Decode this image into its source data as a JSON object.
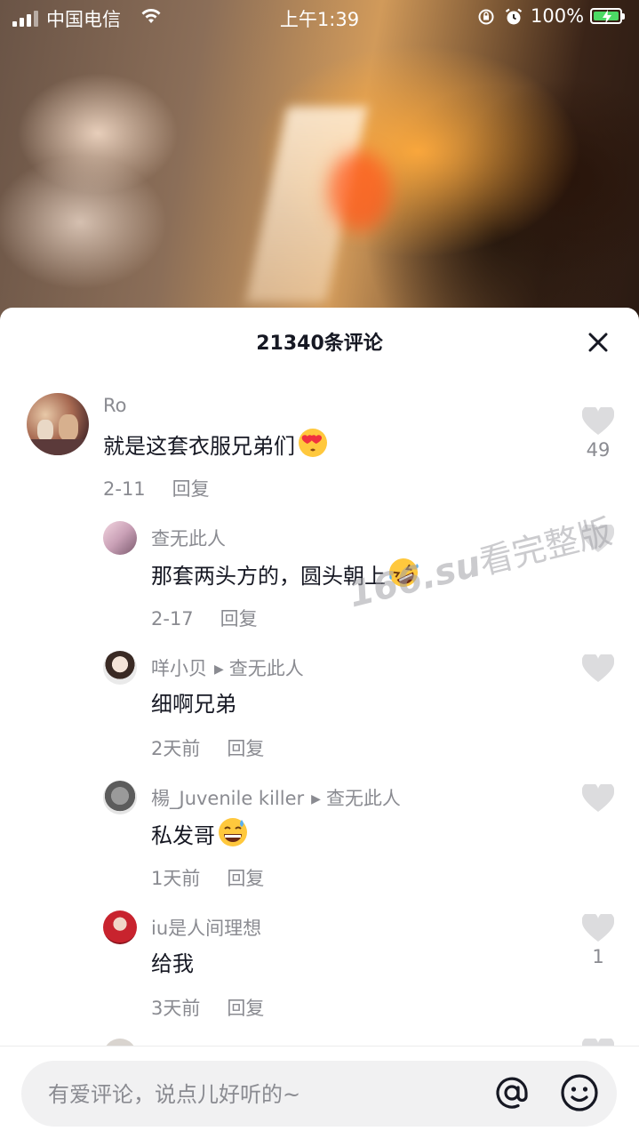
{
  "status_bar": {
    "carrier": "中国电信",
    "time": "上午1:39",
    "battery": "100%"
  },
  "comments_sheet": {
    "title": "21340条评论",
    "comments": [
      {
        "user": "Ro",
        "text": "就是这套衣服兄弟们",
        "emoji": "heart-eyes-emoji",
        "date": "2-11",
        "reply_label": "回复",
        "likes": "49"
      },
      {
        "user": "查无此人",
        "text": "那套两头方的，圆头朝上",
        "emoji": "rofl-emoji",
        "date": "2-17",
        "reply_label": "回复",
        "likes": ""
      },
      {
        "user": "咩小贝",
        "reply_to": "查无此人",
        "text": "细啊兄弟",
        "date": "2天前",
        "reply_label": "回复",
        "likes": ""
      },
      {
        "user": "楊_Juvenile killer",
        "reply_to": "查无此人",
        "text": "私发哥",
        "emoji": "grin-sweat-emoji",
        "date": "1天前",
        "reply_label": "回复",
        "likes": ""
      },
      {
        "user": "iu是人间理想",
        "text": "给我",
        "date": "3天前",
        "reply_label": "回复",
        "likes": "1"
      }
    ]
  },
  "watermark": {
    "prefix": "166.su",
    "suffix": "看完整版"
  },
  "input": {
    "placeholder": "有爱评论，说点儿好听的~"
  },
  "colors": {
    "muted": "#8a8b91",
    "text": "#161823",
    "input_bg": "#f1f1f2"
  }
}
